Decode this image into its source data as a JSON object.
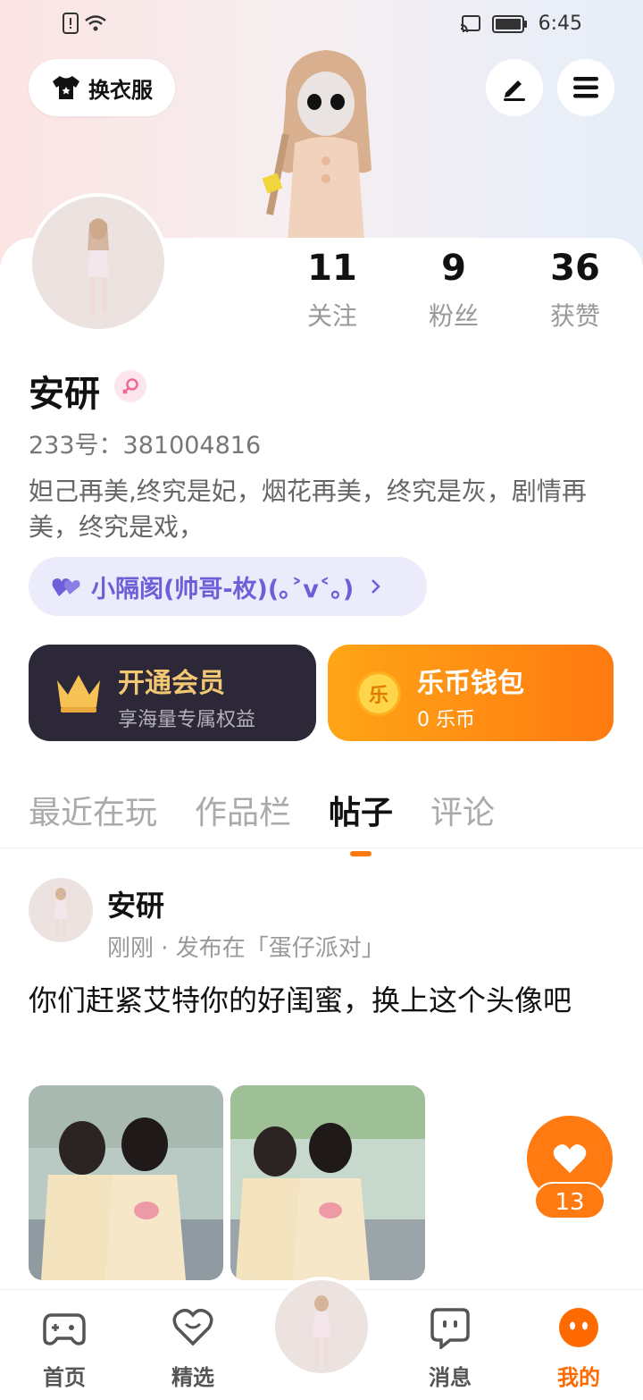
{
  "status_bar": {
    "time": "6:45"
  },
  "header": {
    "outfit_label": "换衣服"
  },
  "stats": [
    {
      "value": "11",
      "label": "关注"
    },
    {
      "value": "9",
      "label": "粉丝"
    },
    {
      "value": "36",
      "label": "获赞"
    }
  ],
  "profile": {
    "name": "安研",
    "id_text": "233号：381004816",
    "bio": "妲己再美,终究是妃，烟花再美，终究是灰，剧情再美，终究是戏，",
    "group": "小隔阂(帅哥-枚)(｡˃v˂｡)"
  },
  "vip": {
    "title": "开通会员",
    "subtitle": "享海量专属权益"
  },
  "wallet": {
    "title": "乐币钱包",
    "subtitle": "0 乐币",
    "coin_char": "乐"
  },
  "tabs": [
    {
      "label": "最近在玩"
    },
    {
      "label": "作品栏"
    },
    {
      "label": "帖子"
    },
    {
      "label": "评论"
    }
  ],
  "post": {
    "author": "安研",
    "meta": "刚刚 · 发布在「蛋仔派对」",
    "text": "你们赶紧艾特你的好闺蜜，换上这个头像吧",
    "likes": "13"
  },
  "nav": [
    {
      "label": "首页"
    },
    {
      "label": "精选"
    },
    {
      "label": "消息"
    },
    {
      "label": "我的"
    }
  ],
  "colors": {
    "accent": "#ff7a10",
    "vip_gold": "#f3c873",
    "group_purple": "#6d5fd8"
  }
}
